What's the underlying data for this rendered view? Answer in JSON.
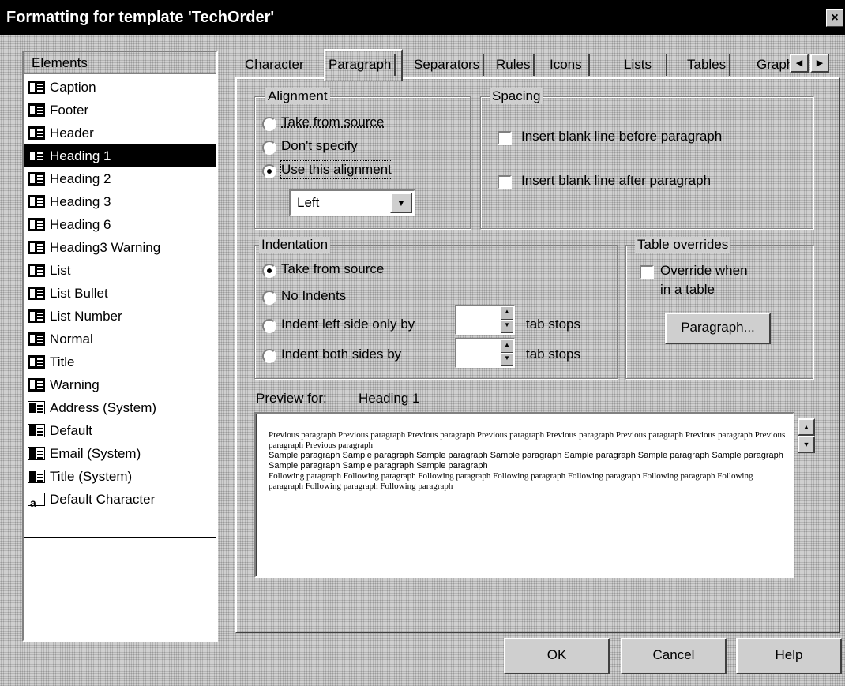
{
  "window": {
    "title": "Formatting for template 'TechOrder'",
    "close_glyph": "×"
  },
  "elements": {
    "header": "Elements",
    "items": [
      {
        "label": "Caption",
        "icon": "paragraph-style-icon"
      },
      {
        "label": "Footer",
        "icon": "paragraph-style-icon"
      },
      {
        "label": "Header",
        "icon": "paragraph-style-icon"
      },
      {
        "label": "Heading 1",
        "icon": "paragraph-style-icon",
        "selected": true
      },
      {
        "label": "Heading 2",
        "icon": "paragraph-style-icon"
      },
      {
        "label": "Heading 3",
        "icon": "paragraph-style-icon"
      },
      {
        "label": "Heading 6",
        "icon": "paragraph-style-icon"
      },
      {
        "label": "Heading3 Warning",
        "icon": "paragraph-style-icon"
      },
      {
        "label": "List",
        "icon": "paragraph-style-icon"
      },
      {
        "label": "List Bullet",
        "icon": "paragraph-style-icon"
      },
      {
        "label": "List Number",
        "icon": "paragraph-style-icon"
      },
      {
        "label": "Normal",
        "icon": "paragraph-style-icon"
      },
      {
        "label": "Title",
        "icon": "paragraph-style-icon"
      },
      {
        "label": "Warning",
        "icon": "paragraph-style-icon"
      },
      {
        "label": "Address (System)",
        "icon": "system-style-icon"
      },
      {
        "label": "Default",
        "icon": "system-style-icon"
      },
      {
        "label": "Email (System)",
        "icon": "system-style-icon"
      },
      {
        "label": "Title (System)",
        "icon": "system-style-icon"
      },
      {
        "label": "Default Character",
        "icon": "character-style-icon"
      }
    ]
  },
  "tabs": [
    {
      "label": "Character"
    },
    {
      "label": "Paragraph",
      "active": true
    },
    {
      "label": "Separators"
    },
    {
      "label": "Rules"
    },
    {
      "label": "Icons"
    },
    {
      "label": "Lists"
    },
    {
      "label": "Tables"
    },
    {
      "label": "Graph"
    }
  ],
  "tab_scroll": {
    "left": "◀",
    "right": "▶"
  },
  "alignment": {
    "label": "Alignment",
    "options": [
      "Take from source",
      "Don't specify",
      "Use this alignment"
    ],
    "selected_index": 2,
    "dropdown_value": "Left",
    "dropdown_arrow": "▼"
  },
  "spacing": {
    "label": "Spacing",
    "before": "Insert blank line before paragraph",
    "after": "Insert blank line after paragraph"
  },
  "indentation": {
    "label": "Indentation",
    "options": [
      "Take from source",
      "No Indents",
      "Indent left side only by",
      "Indent both sides by"
    ],
    "selected_index": 0,
    "unit": "tab stops"
  },
  "table_overrides": {
    "label": "Table overrides",
    "checkbox_line1": "Override when",
    "checkbox_line2": "in a table",
    "button": "Paragraph..."
  },
  "preview": {
    "label": "Preview for:",
    "element": "Heading 1",
    "previous": "Previous paragraph Previous paragraph Previous paragraph Previous paragraph Previous paragraph Previous paragraph Previous paragraph Previous paragraph Previous paragraph",
    "sample": "Sample paragraph Sample paragraph Sample paragraph Sample paragraph Sample paragraph Sample paragraph Sample paragraph Sample paragraph Sample paragraph Sample paragraph",
    "following": "Following paragraph Following paragraph Following paragraph Following paragraph Following paragraph Following paragraph Following paragraph Following paragraph Following paragraph"
  },
  "buttons": {
    "ok": "OK",
    "cancel": "Cancel",
    "help": "Help"
  }
}
